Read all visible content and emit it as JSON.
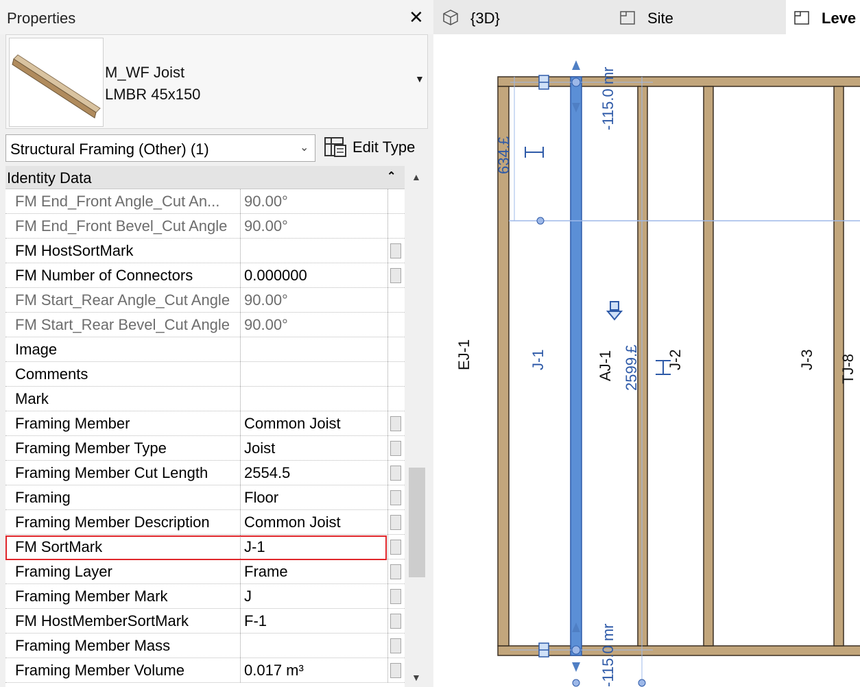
{
  "properties": {
    "title": "Properties",
    "close_glyph": "✕",
    "type_line1": "M_WF Joist",
    "type_line2": "LMBR 45x150",
    "type_dropdown_icon": "dropdown-arrow-icon",
    "filter_label": "Structural Framing (Other) (1)",
    "edit_type_label": "Edit Type",
    "group_header": "Identity Data",
    "rows": [
      {
        "name": "FM End_Front Angle_Cut An...",
        "value": "90.00°"
      },
      {
        "name": "FM End_Front Bevel_Cut Angle",
        "value": "90.00°"
      },
      {
        "name": "FM HostSortMark",
        "value": ""
      },
      {
        "name": "FM Number of Connectors",
        "value": "0.000000"
      },
      {
        "name": "FM Start_Rear Angle_Cut Angle",
        "value": "90.00°"
      },
      {
        "name": "FM Start_Rear Bevel_Cut Angle",
        "value": "90.00°"
      },
      {
        "name": "Image",
        "value": ""
      },
      {
        "name": "Comments",
        "value": ""
      },
      {
        "name": "Mark",
        "value": ""
      },
      {
        "name": "Framing Member",
        "value": "Common Joist"
      },
      {
        "name": "Framing Member Type",
        "value": "Joist"
      },
      {
        "name": "Framing Member Cut Length",
        "value": "2554.5"
      },
      {
        "name": "Framing",
        "value": "Floor"
      },
      {
        "name": "Framing Member Description",
        "value": "Common Joist"
      },
      {
        "name": "FM SortMark",
        "value": "J-1"
      },
      {
        "name": "Framing Layer",
        "value": "Frame"
      },
      {
        "name": "Framing Member Mark",
        "value": "J"
      },
      {
        "name": "FM HostMemberSortMark",
        "value": "F-1"
      },
      {
        "name": "Framing Member Mass",
        "value": ""
      },
      {
        "name": "Framing Member Volume",
        "value": "0.017 m³"
      }
    ],
    "highlighted_row": "FM SortMark"
  },
  "tabs": [
    {
      "label": "{3D}",
      "icon": "3d-view-icon"
    },
    {
      "label": "Site",
      "icon": "plan-view-icon"
    },
    {
      "label": "Leve",
      "icon": "plan-view-icon"
    }
  ],
  "canvas": {
    "member_labels": [
      "EJ-1",
      "J-1",
      "AJ-1",
      "J-2",
      "J-3",
      "TJ-8"
    ],
    "dimension_top": "-115.0 mr",
    "dimension_bottom": "-115.0 mr",
    "dimension_side": "634.£",
    "dimension_length": "2599.£",
    "colors": {
      "wood": "#c2a67c",
      "wood_edge": "#3a2f22",
      "selection": "#5b8fd6",
      "selection_line": "#9db8e8",
      "highlight": "#e0262b"
    }
  }
}
